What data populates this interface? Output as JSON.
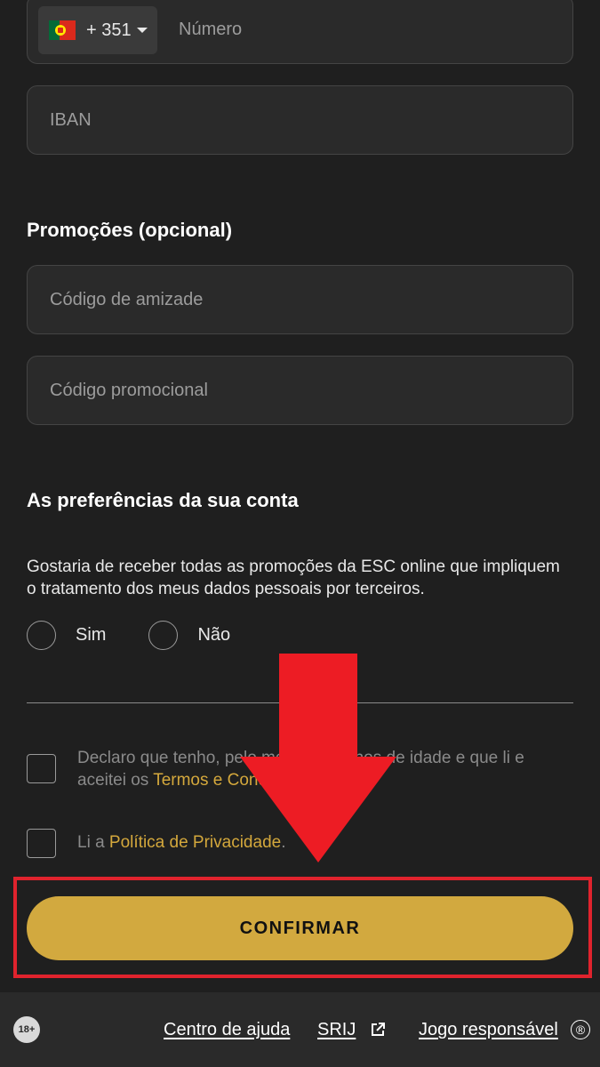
{
  "phone": {
    "country_flag_icon": "portugal-flag-icon",
    "dial_code": "+ 351",
    "placeholder": "Número"
  },
  "iban": {
    "placeholder": "IBAN"
  },
  "promotions": {
    "title": "Promoções (opcional)",
    "friend_code_placeholder": "Código de amizade",
    "promo_code_placeholder": "Código promocional"
  },
  "preferences": {
    "title": "As preferências da sua conta",
    "question": "Gostaria de receber todas as promoções da ESC online que impliquem o tratamento dos meus dados pessoais por terceiros.",
    "yes_label": "Sim",
    "no_label": "Não"
  },
  "consents": {
    "age_prefix": "Declaro que tenho, pelo menos, 18 anos de idade e que li e aceitei os ",
    "terms_link": "Termos e Condições",
    "age_suffix": ".",
    "privacy_prefix": "Li a ",
    "privacy_link": "Política de Privacidade",
    "privacy_suffix": "."
  },
  "confirm_label": "CONFIRMAR",
  "annotation": {
    "highlight_color": "#e0232d",
    "arrow_color": "#ed1c24"
  },
  "footer": {
    "age_badge": "18+",
    "help_link": "Centro de ajuda",
    "srij_link": "SRIJ",
    "responsible_link": "Jogo responsável",
    "registered_mark": "®"
  },
  "colors": {
    "accent": "#d2a93f",
    "background": "#1f1f1f",
    "field": "#2a2a2a"
  }
}
